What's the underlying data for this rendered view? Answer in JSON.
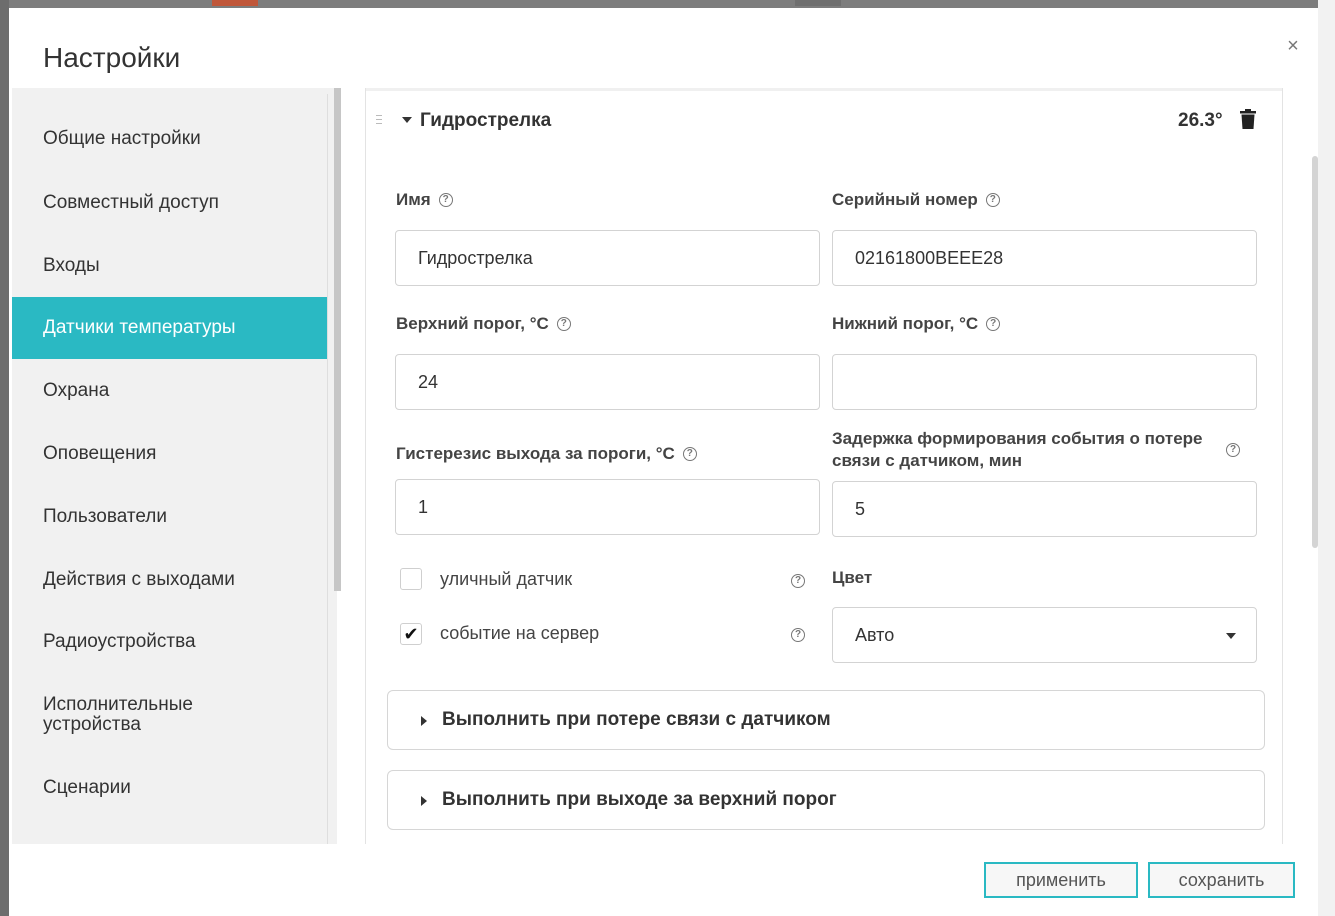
{
  "dialog": {
    "title": "Настройки",
    "close_symbol": "×"
  },
  "sidebar": {
    "items": [
      {
        "label": "Общие настройки",
        "active": false
      },
      {
        "label": "Совместный доступ",
        "active": false
      },
      {
        "label": "Входы",
        "active": false
      },
      {
        "label": "Датчики температуры",
        "active": true
      },
      {
        "label": "Охрана",
        "active": false
      },
      {
        "label": "Оповещения",
        "active": false
      },
      {
        "label": "Пользователи",
        "active": false
      },
      {
        "label": "Действия с выходами",
        "active": false
      },
      {
        "label": "Радиоустройства",
        "active": false
      },
      {
        "label": "Исполнительные устройства",
        "active": false
      },
      {
        "label": "Сценарии",
        "active": false
      }
    ]
  },
  "sensor": {
    "name": "Гидрострелка",
    "temperature": "26.3°",
    "fields": {
      "name_label": "Имя",
      "name_value": "Гидрострелка",
      "serial_label": "Серийный номер",
      "serial_value": "02161800BEEE28",
      "upper_label": "Верхний порог, °C",
      "upper_value": "24",
      "lower_label": "Нижний порог, °C",
      "lower_value": "",
      "hysteresis_label": "Гистерезис выхода за пороги, °C",
      "hysteresis_value": "1",
      "delay_label": "Задержка формирования события о потере связи с датчиком, мин",
      "delay_value": "5",
      "help_symbol": "?"
    },
    "checkboxes": {
      "outdoor_label": "уличный датчик",
      "outdoor_checked": false,
      "server_label": "событие на сервер",
      "server_checked": true,
      "check_symbol": "✔"
    },
    "color": {
      "label": "Цвет",
      "value": "Авто"
    },
    "panels": [
      "Выполнить при потере связи с датчиком",
      "Выполнить при выходе за верхний порог"
    ]
  },
  "footer": {
    "apply_label": "применить",
    "save_label": "сохранить"
  },
  "colors": {
    "accent": "#2ab9c3"
  },
  "icons": [
    "close-icon",
    "drag-handle-icon",
    "caret-down-icon",
    "trash-icon",
    "help-icon",
    "check-icon",
    "dropdown-arrow-icon",
    "caret-right-icon"
  ]
}
